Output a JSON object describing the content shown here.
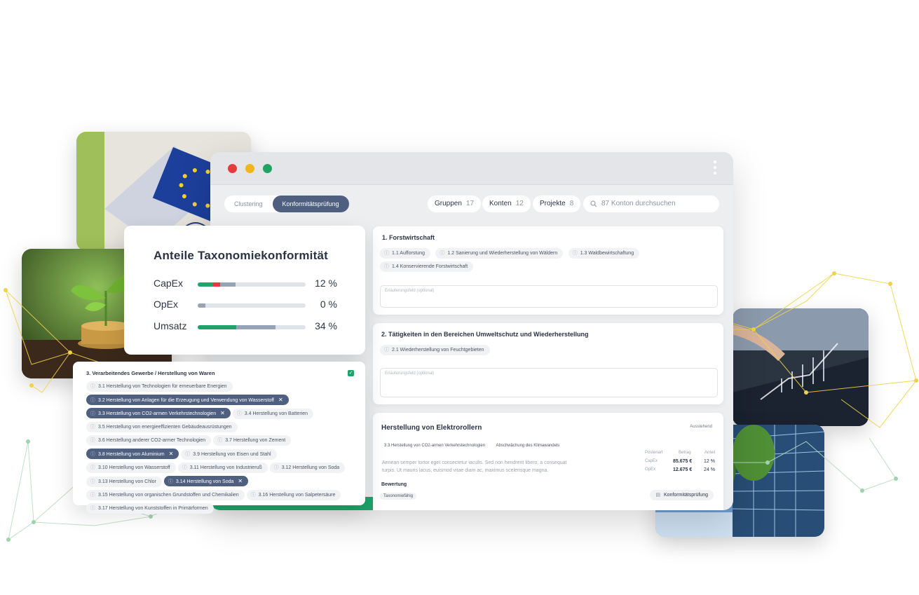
{
  "window": {
    "tabs": [
      "Clustering",
      "Konformitätsprüfung"
    ],
    "active_tab": 1,
    "filters": [
      {
        "label": "Gruppen",
        "count": "17"
      },
      {
        "label": "Konten",
        "count": "12"
      },
      {
        "label": "Projekte",
        "count": "8"
      }
    ],
    "search_placeholder": "87 Konton durchsuchen"
  },
  "taxonomy": {
    "title": "Anteile Taxonomiekonformität",
    "rows": [
      {
        "label": "CapEx",
        "value": "12 %",
        "green": 0.14,
        "red": 0.07,
        "gray": 0.14
      },
      {
        "label": "OpEx",
        "value": "0 %",
        "green": 0,
        "red": 0,
        "gray": 0.07
      },
      {
        "label": "Umsatz",
        "value": "34 %",
        "green": 0.36,
        "red": 0,
        "gray": 0.36
      }
    ],
    "colors": {
      "green": "#1fa36a",
      "red": "#e4393f",
      "gray": "#97a3b6"
    }
  },
  "forst": {
    "title": "1. Forstwirtschaft",
    "tags": [
      "1.1  Aufforstung",
      "1.2  Sanierung und Wiederherstellung von Wäldern",
      "1.3  Waldbewirtschaftung",
      "1.4  Konservierende Forstwirtschaft"
    ],
    "textarea_label": "Erläuterungsfeld (optional)"
  },
  "umwelt": {
    "title": "2. Tätigkeiten in den Bereichen Umweltschutz und Wiederherstellung",
    "tags": [
      "2.1 Wiederherstellung von Feuchtgebieten"
    ],
    "textarea_label": "Erläuterungsfeld (optional)"
  },
  "manufacturing": {
    "title": "3. Verarbeitendes Gewerbe / Herstellung von Waren",
    "tags": [
      {
        "label": "3.1 Herstellung von Technologien für erneuerbare Energien",
        "selected": false
      },
      {
        "label": "3.2 Herstellung von Anlagen für die Erzeugung und Verwendung von Wasserstoff",
        "selected": true
      },
      {
        "label": "3.3 Herstellung von CO2-armen Verkehrstechnologien",
        "selected": true
      },
      {
        "label": "3.4 Herstellung von Batterien",
        "selected": false
      },
      {
        "label": "3.5 Herstellung von energieeffizienten Gebäudeausrüstungen",
        "selected": false
      },
      {
        "label": "3.6 Herstellung anderer CO2-armer Technologien",
        "selected": false
      },
      {
        "label": "3.7 Herstellung von Zement",
        "selected": false
      },
      {
        "label": "3.8 Herstellung von Aluminium",
        "selected": true
      },
      {
        "label": "3.9 Herstellung von Eisen und Stahl",
        "selected": false
      },
      {
        "label": "3.10 Herstellung von Wasserstoff",
        "selected": false
      },
      {
        "label": "3.11 Herstellung von Industrieruß",
        "selected": false
      },
      {
        "label": "3.12 Herstellung von Soda",
        "selected": false
      },
      {
        "label": "3.13 Herstellung von Chlor",
        "selected": false
      },
      {
        "label": "3.14 Herstellung von Soda",
        "selected": true
      },
      {
        "label": "3.15 Herstellung von organischen Grundstoffen und Chemikalien",
        "selected": false
      },
      {
        "label": "3.16 Herstellung von Salpetersäure",
        "selected": false
      },
      {
        "label": "3.17 Herstellung von Kunststoffen in Primärformen",
        "selected": false
      }
    ]
  },
  "scooter": {
    "title": "Herstellung von Elektrorollern",
    "status": "Ausstehend",
    "activity": "3.3  Herstellung von CO2-armen Verkehrstechnologien",
    "goal": "Abschwächung des Klimawandels",
    "description": "Aenean semper tortor eget consectetur iaculis. Sed non hendrerit libero, a consequat turpis. Ut mauris lacus, euismod vitae diam ac, maximus scelerisque magna.",
    "table_headers": [
      "Postenart",
      "Betrag",
      "Anteil"
    ],
    "table_rows": [
      {
        "type": "CapEx",
        "amount": "85.675 €",
        "share": "12 %"
      },
      {
        "type": "OpEx",
        "amount": "12.675 €",
        "share": "24 %"
      }
    ],
    "rating_label": "Bewertung",
    "rating_value": "Taxonomiefähig",
    "check_button": "Konformitätsprüfung"
  }
}
